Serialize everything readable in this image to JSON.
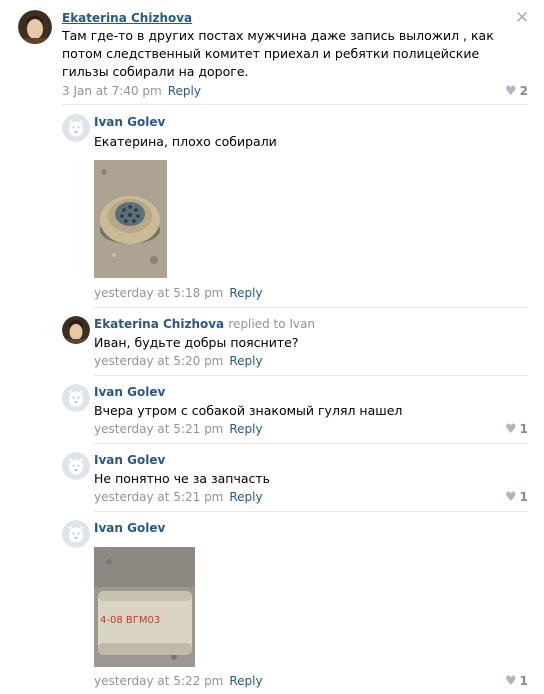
{
  "comments": [
    {
      "author": "Ekaterina Chizhova",
      "text": "Там где-то в других постах мужчина даже запись выложил , как потом следственный комитет приехал и ребятки полицейские гильзы собирали на дороге.",
      "time": "3 Jan at 7:40 pm",
      "reply": "Reply",
      "likes": "2"
    },
    {
      "author": "Ivan Golev",
      "text": "Екатерина, плохо собирали",
      "time": "yesterday at 5:18 pm",
      "reply": "Reply",
      "likes": ""
    },
    {
      "author": "Ekaterina Chizhova",
      "replied_to": "replied to Ivan",
      "text": "Иван, будьте добры поясните?",
      "time": "yesterday at 5:20 pm",
      "reply": "Reply",
      "likes": ""
    },
    {
      "author": "Ivan Golev",
      "text": "Вчера утром с собакой знакомый гулял нашел",
      "time": "yesterday at 5:21 pm",
      "reply": "Reply",
      "likes": "1"
    },
    {
      "author": "Ivan Golev",
      "text": "Не понятно че за запчасть",
      "time": "yesterday at 5:21 pm",
      "reply": "Reply",
      "likes": "1"
    },
    {
      "author": "Ivan Golev",
      "text": "",
      "time": "yesterday at 5:22 pm",
      "reply": "Reply",
      "likes": "1"
    }
  ],
  "photo_2_marking": "4-08  ВГМ03",
  "icons": {
    "close": "close-icon",
    "like": "heart-icon",
    "avatar_default": "dog-avatar-icon"
  },
  "colors": {
    "link": "#2a5885",
    "meta": "#939393",
    "divider": "#e7e8ec"
  }
}
